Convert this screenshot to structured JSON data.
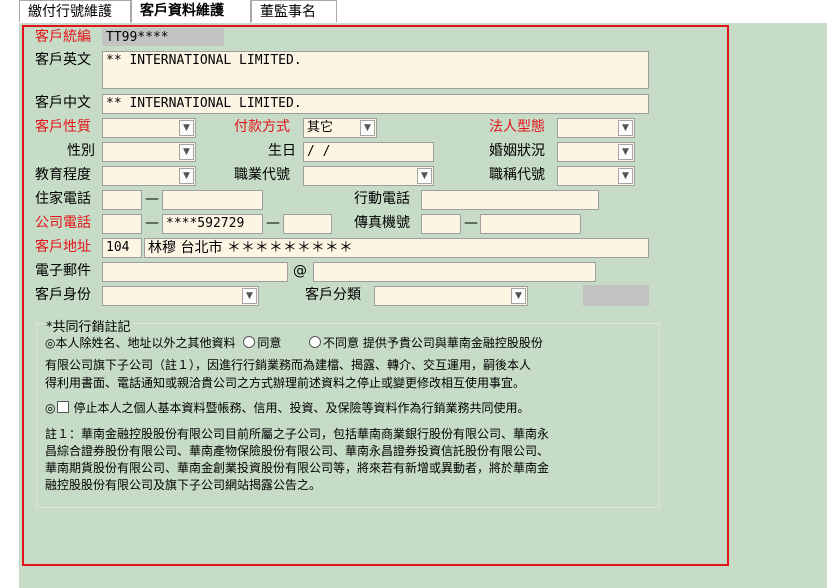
{
  "tabs": [
    "繳付行號維護",
    "客戶資料維護",
    "董監事名單"
  ],
  "form": {
    "customer_id_label": "客戶統編",
    "customer_id_value": "TT99****",
    "english_name_label": "客戶英文",
    "english_name_value": "** INTERNATIONAL LIMITED.",
    "chinese_name_label": "客戶中文",
    "chinese_name_value": "** INTERNATIONAL LIMITED.",
    "customer_type_label": "客戶性質",
    "payment_method_label": "付款方式",
    "payment_method_value": "其它",
    "legal_type_label": "法人型態",
    "gender_label": "性別",
    "birthday_label": "生日",
    "birthday_value": " / /",
    "marital_label": "婚姻狀況",
    "education_label": "教育程度",
    "occupation_label": "職業代號",
    "title_label": "職稱代號",
    "home_phone_label": "住家電話",
    "mobile_label": "行動電話",
    "company_phone_label": "公司電話",
    "company_phone_number": "****592729",
    "fax_label": "傳真機號",
    "address_label": "客戶地址",
    "address_zip": "104",
    "address_value": "林穆 台北市 ＊＊＊＊＊＊＊＊＊",
    "email_label": "電子郵件",
    "email_at": "@",
    "identity_label": "客戶身份",
    "category_label": "客戶分類",
    "dash": "—"
  },
  "marketing": {
    "legend": "*共同行銷註記",
    "line1_prefix": "◎本人除姓名、地址以外之其他資料",
    "agree": "同意",
    "disagree": "不同意",
    "line1_suffix": "提供予貴公司與華南金融控股股份",
    "line2": "有限公司旗下子公司（註１），因進行行銷業務而為建檔、揭露、轉介、交互運用，嗣後本人",
    "line3": "得利用書面、電話通知或親洽貴公司之方式辦理前述資料之停止或變更修改相互使用事宜。",
    "stop_prefix": "◎",
    "stop_text": "停止本人之個人基本資料暨帳務、信用、投資、及保險等資料作為行銷業務共同使用。",
    "note1": "註１：華南金融控股股份有限公司目前所屬之子公司，包括華南商業銀行股份有限公司、華南永",
    "note2": "昌綜合證券股份有限公司、華南產物保險股份有限公司、華南永昌證券投資信託股份有限公司、",
    "note3": "華南期貨股份有限公司、華南金創業投資股份有限公司等，將來若有新增或異動者，將於華南金",
    "note4": "融控股股份有限公司及旗下子公司網站揭露公告之。"
  },
  "colors": {
    "panel": "#c6dcc6",
    "required": "#e3131b",
    "field": "#fdf5e4"
  }
}
